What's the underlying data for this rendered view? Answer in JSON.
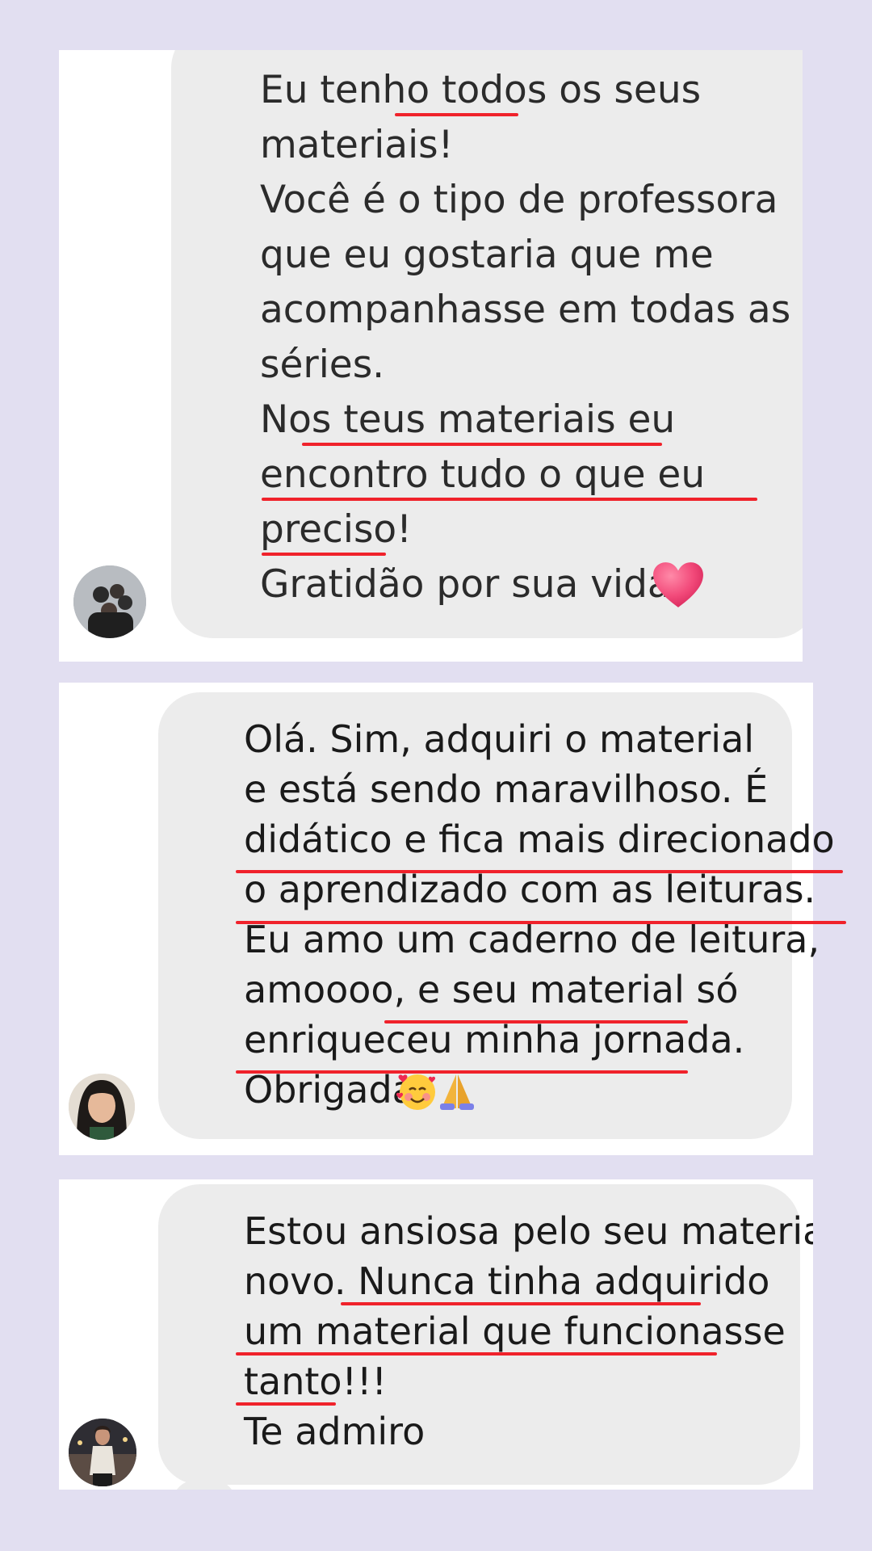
{
  "messages": [
    {
      "lines": [
        "Eu tenho todos os seus",
        "materiais!",
        "Você é o tipo de professora",
        "que eu gostaria que me",
        "acompanhasse em todas as",
        "séries.",
        "Nos teus materiais eu",
        "encontro tudo o que eu",
        "preciso!",
        "Gratidão por sua vida"
      ],
      "emoji": "heart-icon"
    },
    {
      "lines": [
        "Olá. Sim, adquiri o material",
        "e está sendo maravilhoso.  É",
        "didático e fica mais direcionado",
        "o aprendizado com as leituras.",
        "Eu amo um caderno de leitura,",
        "amoooo, e seu material só",
        "enriqueceu minha jornada.",
        "Obrigada"
      ],
      "emoji": [
        "smiling-face-with-hearts-icon",
        "folded-hands-icon"
      ]
    },
    {
      "lines": [
        "Estou ansiosa pelo seu material",
        "novo. Nunca tinha adquirido",
        "um material que funcionasse",
        "tanto!!!",
        "Te admiro"
      ]
    }
  ],
  "colors": {
    "page_background": "#e2dff1",
    "card_background": "#ffffff",
    "bubble_background": "#ececec",
    "underline": "#f0222b",
    "heart": "#f24a7a"
  }
}
